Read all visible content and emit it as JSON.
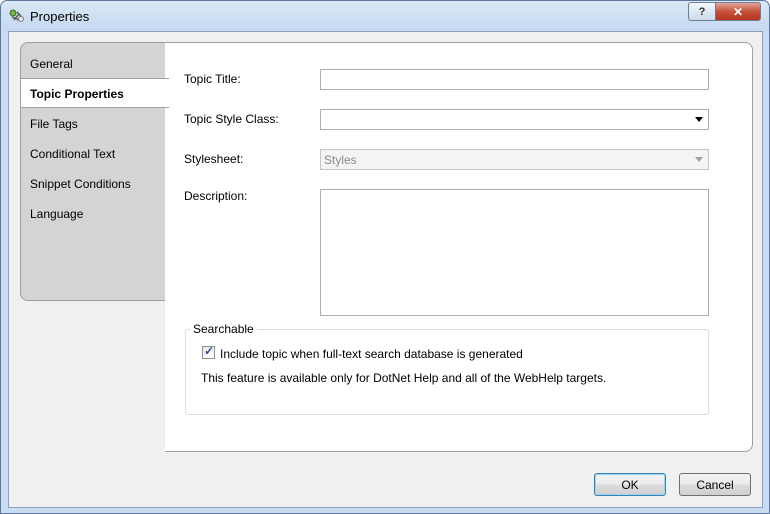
{
  "window": {
    "title": "Properties",
    "help_label": "?",
    "close_label": "✕"
  },
  "tabs": [
    {
      "label": "General"
    },
    {
      "label": "Topic Properties",
      "active": true
    },
    {
      "label": "File Tags"
    },
    {
      "label": "Conditional Text"
    },
    {
      "label": "Snippet Conditions"
    },
    {
      "label": "Language"
    }
  ],
  "form": {
    "topic_title_label": "Topic Title:",
    "topic_title_value": "",
    "style_class_label": "Topic Style Class:",
    "style_class_value": "",
    "stylesheet_label": "Stylesheet:",
    "stylesheet_value": "Styles",
    "description_label": "Description:",
    "description_value": ""
  },
  "searchable": {
    "group_title": "Searchable",
    "checkbox_label": "Include topic when full-text search database is generated",
    "checked": true,
    "note": "This feature is available only for DotNet Help and all of the WebHelp targets."
  },
  "buttons": {
    "ok": "OK",
    "cancel": "Cancel"
  },
  "colors": {
    "title_bar": "#c4d8ef",
    "close_button": "#c6513a",
    "default_button_border": "#3c7fb1"
  }
}
